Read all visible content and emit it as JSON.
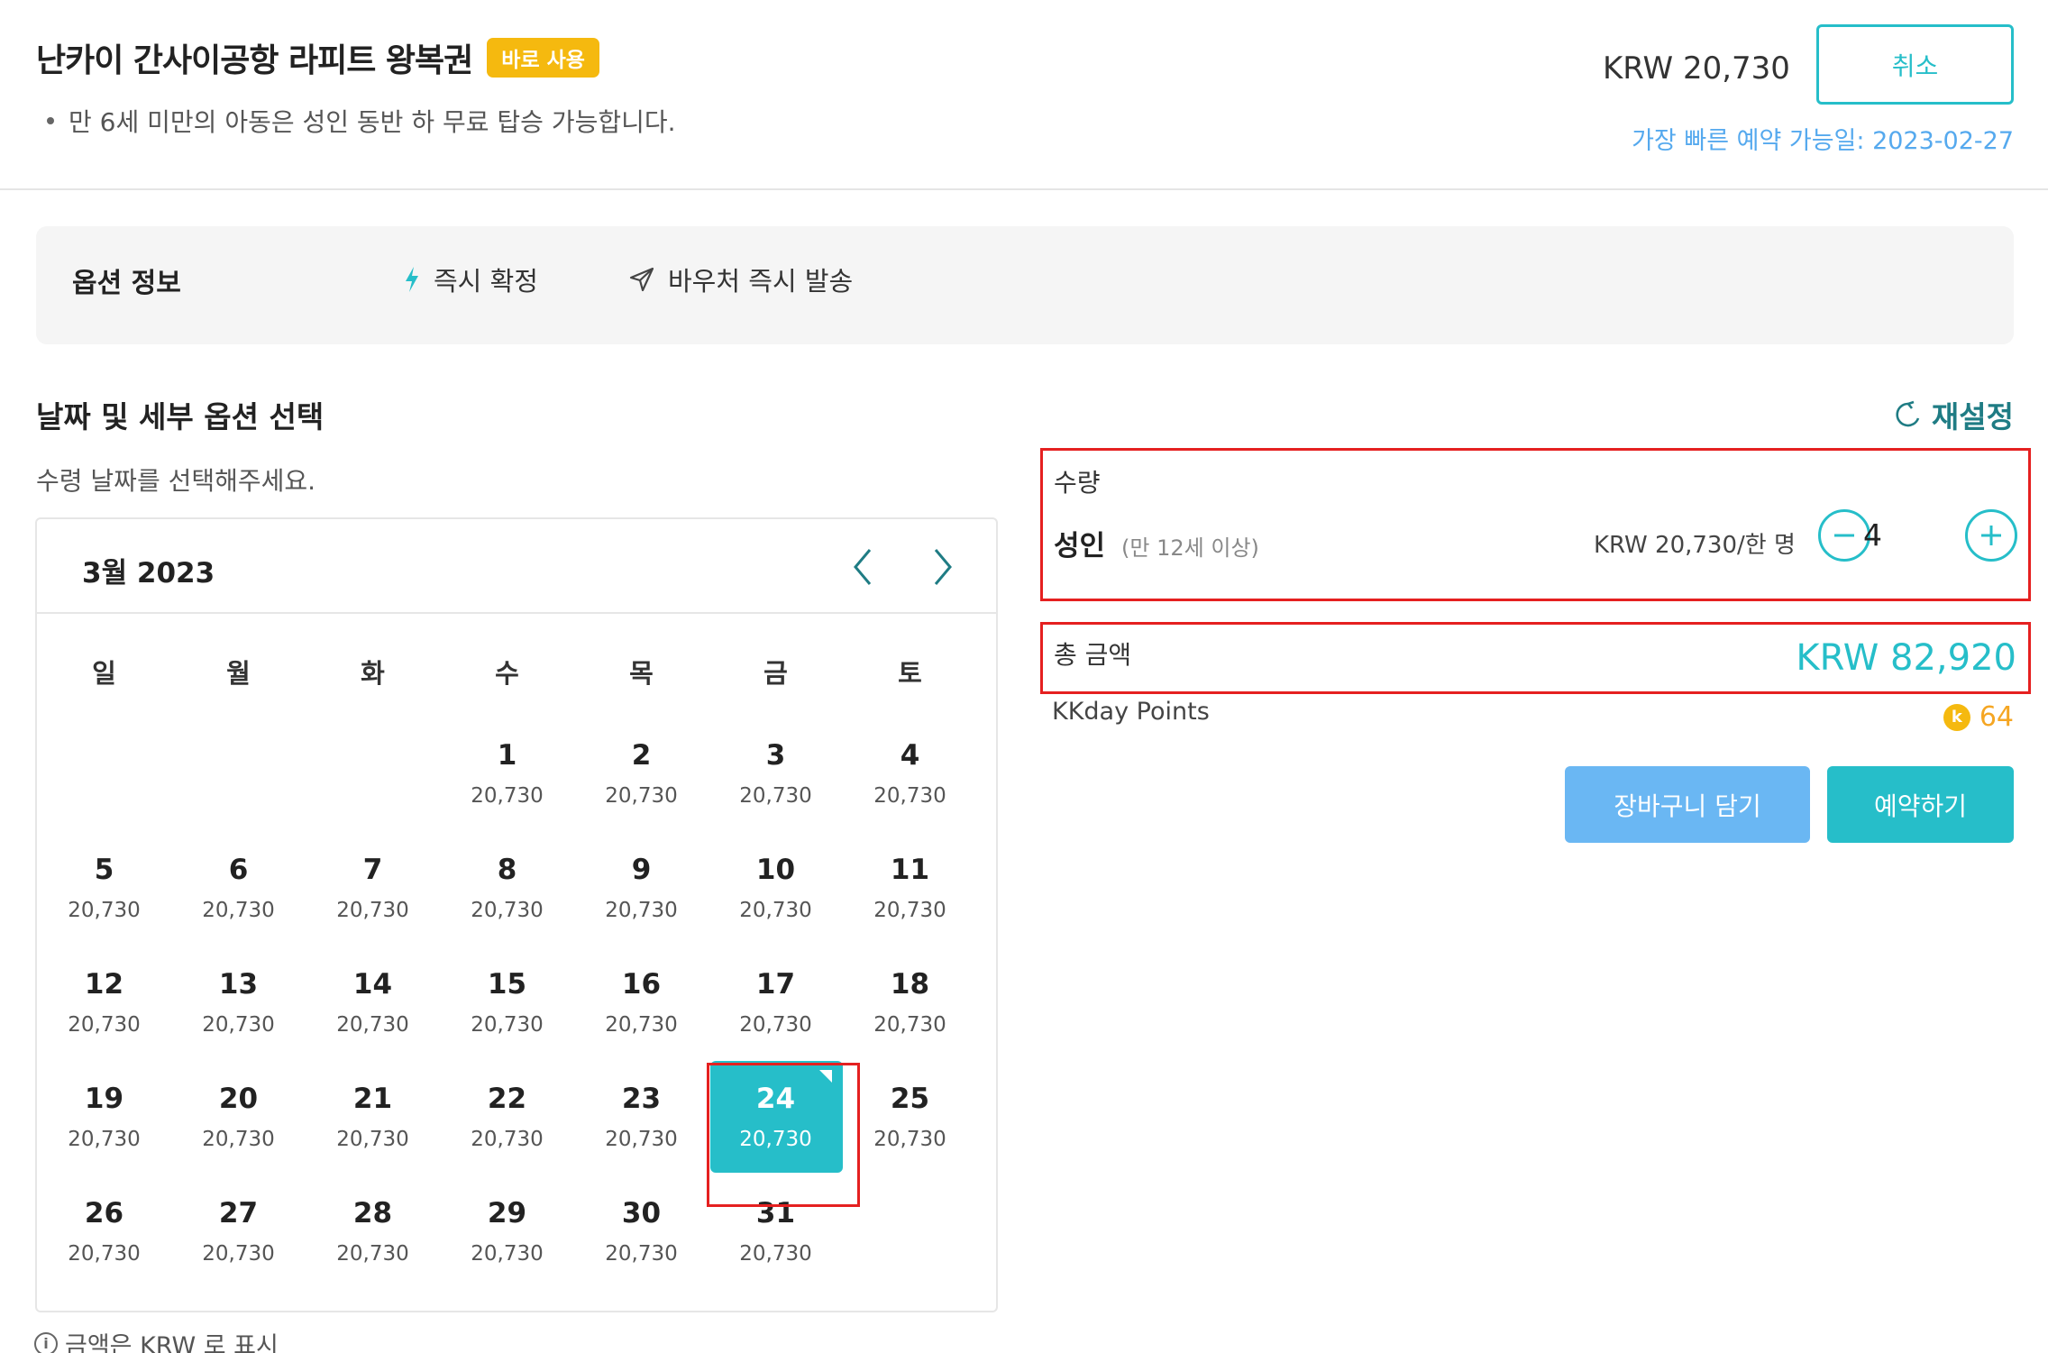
{
  "header": {
    "title": "난카이 간사이공항 라피트 왕복권",
    "badge": "바로 사용",
    "note": "만 6세 미만의 아동은 성인 동반 하 무료 탑승 가능합니다.",
    "price": "KRW 20,730",
    "cancel_label": "취소",
    "earliest": "가장 빠른 예약 가능일: 2023-02-27"
  },
  "options": {
    "title": "옵션 정보",
    "instant_confirm": "즉시 확정",
    "voucher": "바우처 즉시 발송"
  },
  "section": {
    "title": "날짜 및 세부 옵션 선택",
    "reset_label": "재설정",
    "hint": "수령 날짜를 선택해주세요."
  },
  "calendar": {
    "month_label": "3월 2023",
    "weekdays": [
      "일",
      "월",
      "화",
      "수",
      "목",
      "금",
      "토"
    ],
    "weeks": [
      [
        null,
        null,
        null,
        {
          "day": "1",
          "price": "20,730"
        },
        {
          "day": "2",
          "price": "20,730"
        },
        {
          "day": "3",
          "price": "20,730"
        },
        {
          "day": "4",
          "price": "20,730"
        }
      ],
      [
        {
          "day": "5",
          "price": "20,730"
        },
        {
          "day": "6",
          "price": "20,730"
        },
        {
          "day": "7",
          "price": "20,730"
        },
        {
          "day": "8",
          "price": "20,730"
        },
        {
          "day": "9",
          "price": "20,730"
        },
        {
          "day": "10",
          "price": "20,730"
        },
        {
          "day": "11",
          "price": "20,730"
        }
      ],
      [
        {
          "day": "12",
          "price": "20,730"
        },
        {
          "day": "13",
          "price": "20,730"
        },
        {
          "day": "14",
          "price": "20,730"
        },
        {
          "day": "15",
          "price": "20,730"
        },
        {
          "day": "16",
          "price": "20,730"
        },
        {
          "day": "17",
          "price": "20,730"
        },
        {
          "day": "18",
          "price": "20,730"
        }
      ],
      [
        {
          "day": "19",
          "price": "20,730"
        },
        {
          "day": "20",
          "price": "20,730"
        },
        {
          "day": "21",
          "price": "20,730"
        },
        {
          "day": "22",
          "price": "20,730"
        },
        {
          "day": "23",
          "price": "20,730"
        },
        {
          "day": "24",
          "price": "20,730",
          "selected": true
        },
        {
          "day": "25",
          "price": "20,730"
        }
      ],
      [
        {
          "day": "26",
          "price": "20,730"
        },
        {
          "day": "27",
          "price": "20,730"
        },
        {
          "day": "28",
          "price": "20,730"
        },
        {
          "day": "29",
          "price": "20,730"
        },
        {
          "day": "30",
          "price": "20,730"
        },
        {
          "day": "31",
          "price": "20,730"
        },
        null
      ]
    ],
    "footnote": "금액은 KRW 로 표시"
  },
  "quantity": {
    "label": "수량",
    "adult_label": "성인",
    "adult_sub": "(만 12세 이상)",
    "unit_price": "KRW 20,730/한 명",
    "value": "4"
  },
  "total": {
    "label": "총 금액",
    "value": "KRW 82,920"
  },
  "points": {
    "label": "KKday Points",
    "coin": "k",
    "value": "64"
  },
  "actions": {
    "cart_label": "장바구니 담기",
    "book_label": "예약하기"
  },
  "colors": {
    "accent": "#26bec9",
    "badge": "#f5b90f",
    "cart": "#6ab7f3",
    "highlight": "#e52020"
  }
}
